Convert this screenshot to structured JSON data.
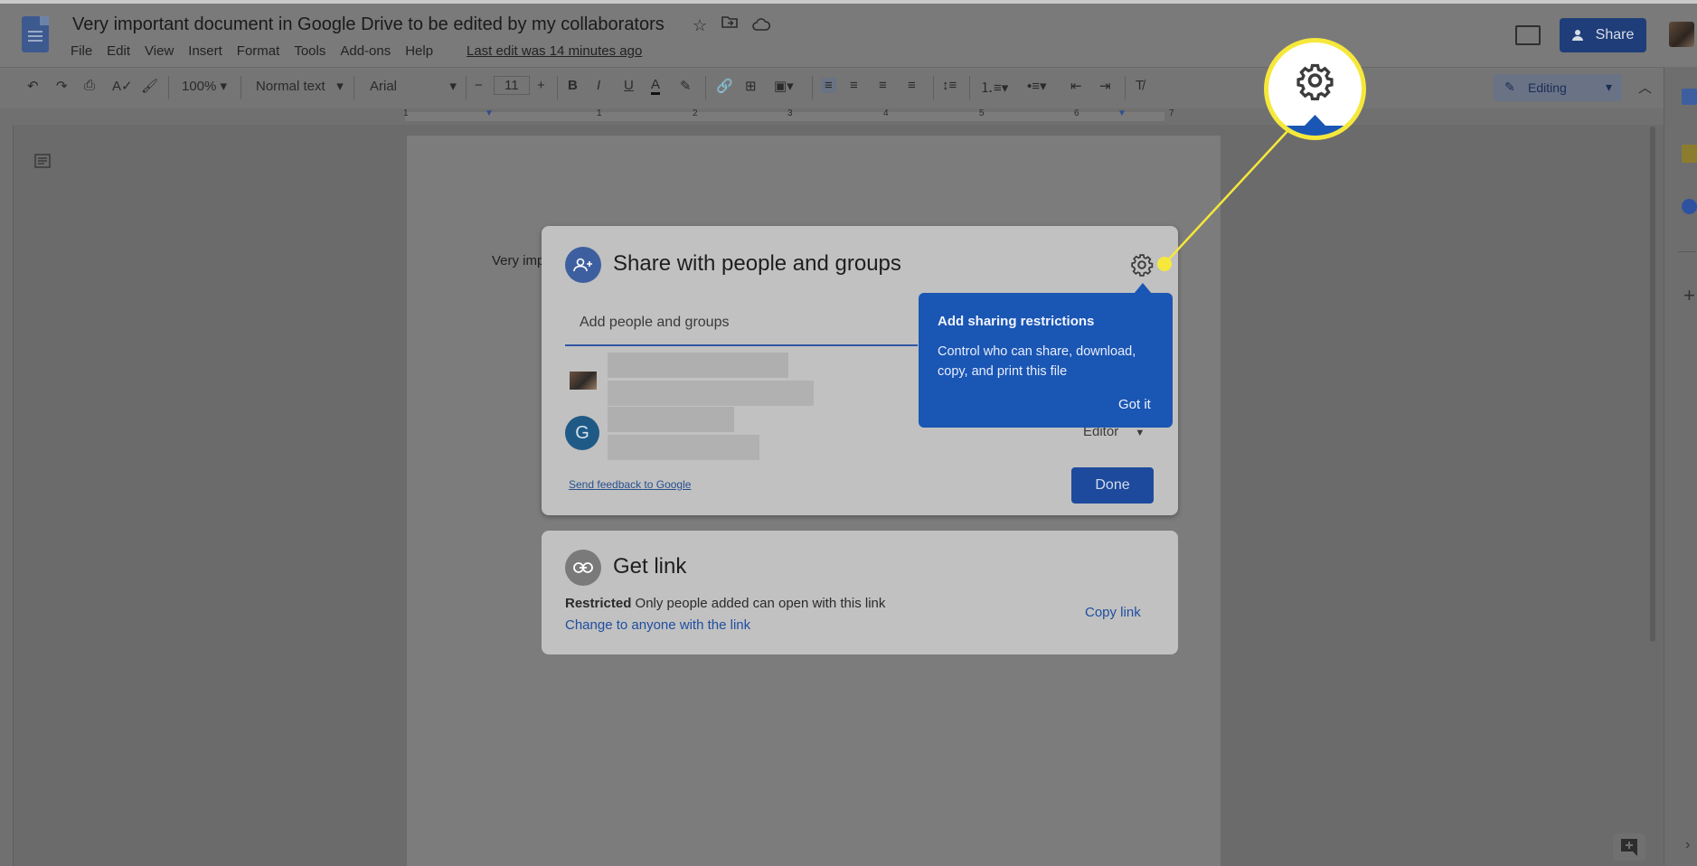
{
  "document": {
    "title": "Very important document in Google Drive to be edited by my collaborators",
    "last_edit": "Last edit was 14 minutes ago",
    "page_text": "Very imp"
  },
  "menu": [
    "File",
    "Edit",
    "View",
    "Insert",
    "Format",
    "Tools",
    "Add-ons",
    "Help"
  ],
  "header": {
    "share_label": "Share"
  },
  "toolbar": {
    "zoom": "100%",
    "style": "Normal text",
    "font": "Arial",
    "font_size": "11",
    "mode": "Editing"
  },
  "ruler": [
    "1",
    "1",
    "2",
    "3",
    "4",
    "5",
    "6",
    "7"
  ],
  "share_dialog": {
    "title": "Share with people and groups",
    "input_placeholder": "Add people and groups",
    "person2_initial": "G",
    "role": "Editor",
    "feedback_link": "Send feedback to Google",
    "done_label": "Done"
  },
  "tooltip": {
    "title": "Add sharing restrictions",
    "body": "Control who can share, download, copy, and print this file",
    "dismiss": "Got it"
  },
  "get_link": {
    "title": "Get link",
    "restriction_label": "Restricted",
    "restriction_desc": "Only people added can open with this link",
    "change_link": "Change to anyone with the link",
    "copy_link": "Copy link"
  },
  "colors": {
    "accent": "#1a56b3",
    "callout": "#f6e83a"
  }
}
